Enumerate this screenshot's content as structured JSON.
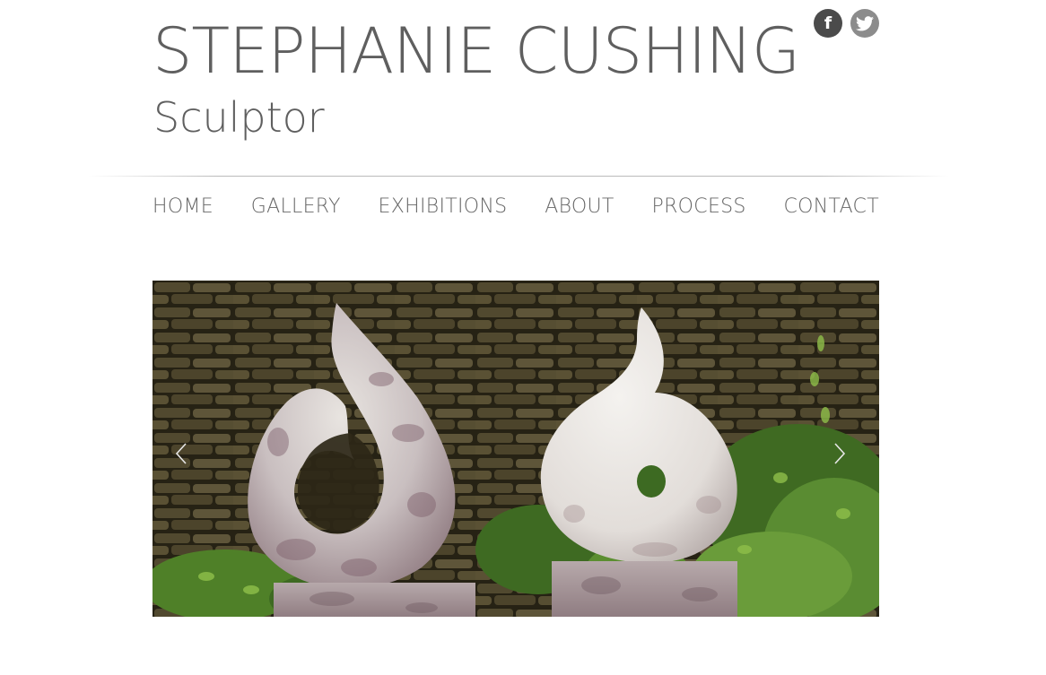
{
  "header": {
    "title": "STEPHANIE CUSHING",
    "subtitle": "Sculptor"
  },
  "social": [
    {
      "name": "facebook",
      "icon": "facebook-icon",
      "glyph": "f",
      "color": "#4b4b4b"
    },
    {
      "name": "twitter",
      "icon": "twitter-icon",
      "color": "#8c8c8c"
    }
  ],
  "nav": {
    "items": [
      {
        "label": "HOME"
      },
      {
        "label": "GALLERY"
      },
      {
        "label": "EXHIBITIONS"
      },
      {
        "label": "ABOUT"
      },
      {
        "label": "PROCESS"
      },
      {
        "label": "CONTACT"
      }
    ]
  },
  "slider": {
    "prev_icon": "chevron-left-icon",
    "next_icon": "chevron-right-icon"
  },
  "colors": {
    "text": "#5f5f5f",
    "nav_text": "#666666",
    "divider": "#bbbbbb"
  }
}
